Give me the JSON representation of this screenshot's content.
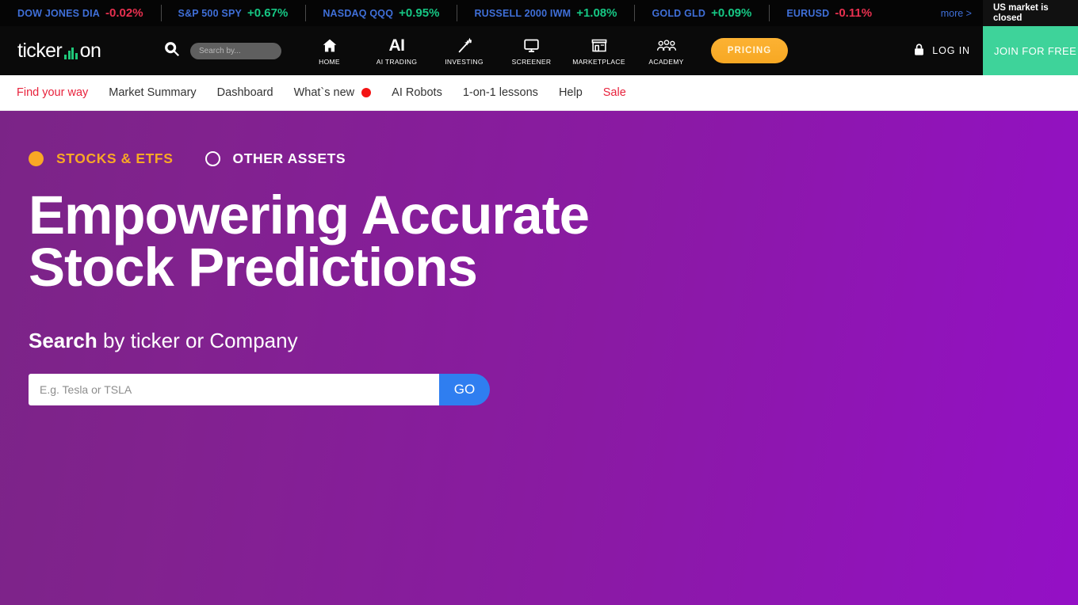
{
  "ticker": {
    "items": [
      {
        "name": "DOW JONES DIA",
        "value": "-0.02%",
        "dir": "down"
      },
      {
        "name": "S&P 500 SPY",
        "value": "+0.67%",
        "dir": "up"
      },
      {
        "name": "NASDAQ QQQ",
        "value": "+0.95%",
        "dir": "up"
      },
      {
        "name": "RUSSELL 2000 IWM",
        "value": "+1.08%",
        "dir": "up"
      },
      {
        "name": "GOLD GLD",
        "value": "+0.09%",
        "dir": "up"
      },
      {
        "name": "EURUSD",
        "value": "-0.11%",
        "dir": "down"
      }
    ],
    "more_label": "more >",
    "market_status_line1": "US market is",
    "market_status_line2": "closed"
  },
  "header": {
    "logo_part1": "ticker",
    "logo_part2": "on",
    "search_placeholder": "Search by...",
    "nav": [
      {
        "label": "HOME",
        "icon": "home-icon"
      },
      {
        "label": "AI TRADING",
        "icon": "ai-text-icon"
      },
      {
        "label": "INVESTING",
        "icon": "magic-wand-icon"
      },
      {
        "label": "SCREENER",
        "icon": "monitor-icon"
      },
      {
        "label": "MARKETPLACE",
        "icon": "storefront-icon"
      },
      {
        "label": "ACADEMY",
        "icon": "people-group-icon"
      }
    ],
    "pricing_label": "PRICING",
    "login_label": "LOG IN",
    "join_label": "JOIN FOR FREE"
  },
  "subnav": {
    "items": [
      {
        "label": "Find your way",
        "accent": true
      },
      {
        "label": "Market Summary",
        "accent": false
      },
      {
        "label": "Dashboard",
        "accent": false
      },
      {
        "label": "What`s new",
        "accent": false,
        "dot": true
      },
      {
        "label": "AI Robots",
        "accent": false
      },
      {
        "label": "1-on-1 lessons",
        "accent": false
      },
      {
        "label": "Help",
        "accent": false
      },
      {
        "label": "Sale",
        "accent": true
      }
    ]
  },
  "hero": {
    "asset_selected_label": "STOCKS & ETFS",
    "asset_other_label": "OTHER ASSETS",
    "headline": "Empowering Accurate Stock Predictions",
    "subhead_bold": "Search",
    "subhead_rest": " by ticker or Company",
    "search_placeholder": "E.g. Tesla or TSLA",
    "search_value": "",
    "go_label": "GO"
  },
  "colors": {
    "accent_orange": "#f9a825",
    "brand_green": "#3ed39a",
    "up_green": "#16c784",
    "down_red": "#e8304f",
    "link_blue": "#3f6fd8",
    "go_blue": "#2f7ef0",
    "hero_purple_left": "#7b2487",
    "hero_purple_right": "#9410c6"
  }
}
